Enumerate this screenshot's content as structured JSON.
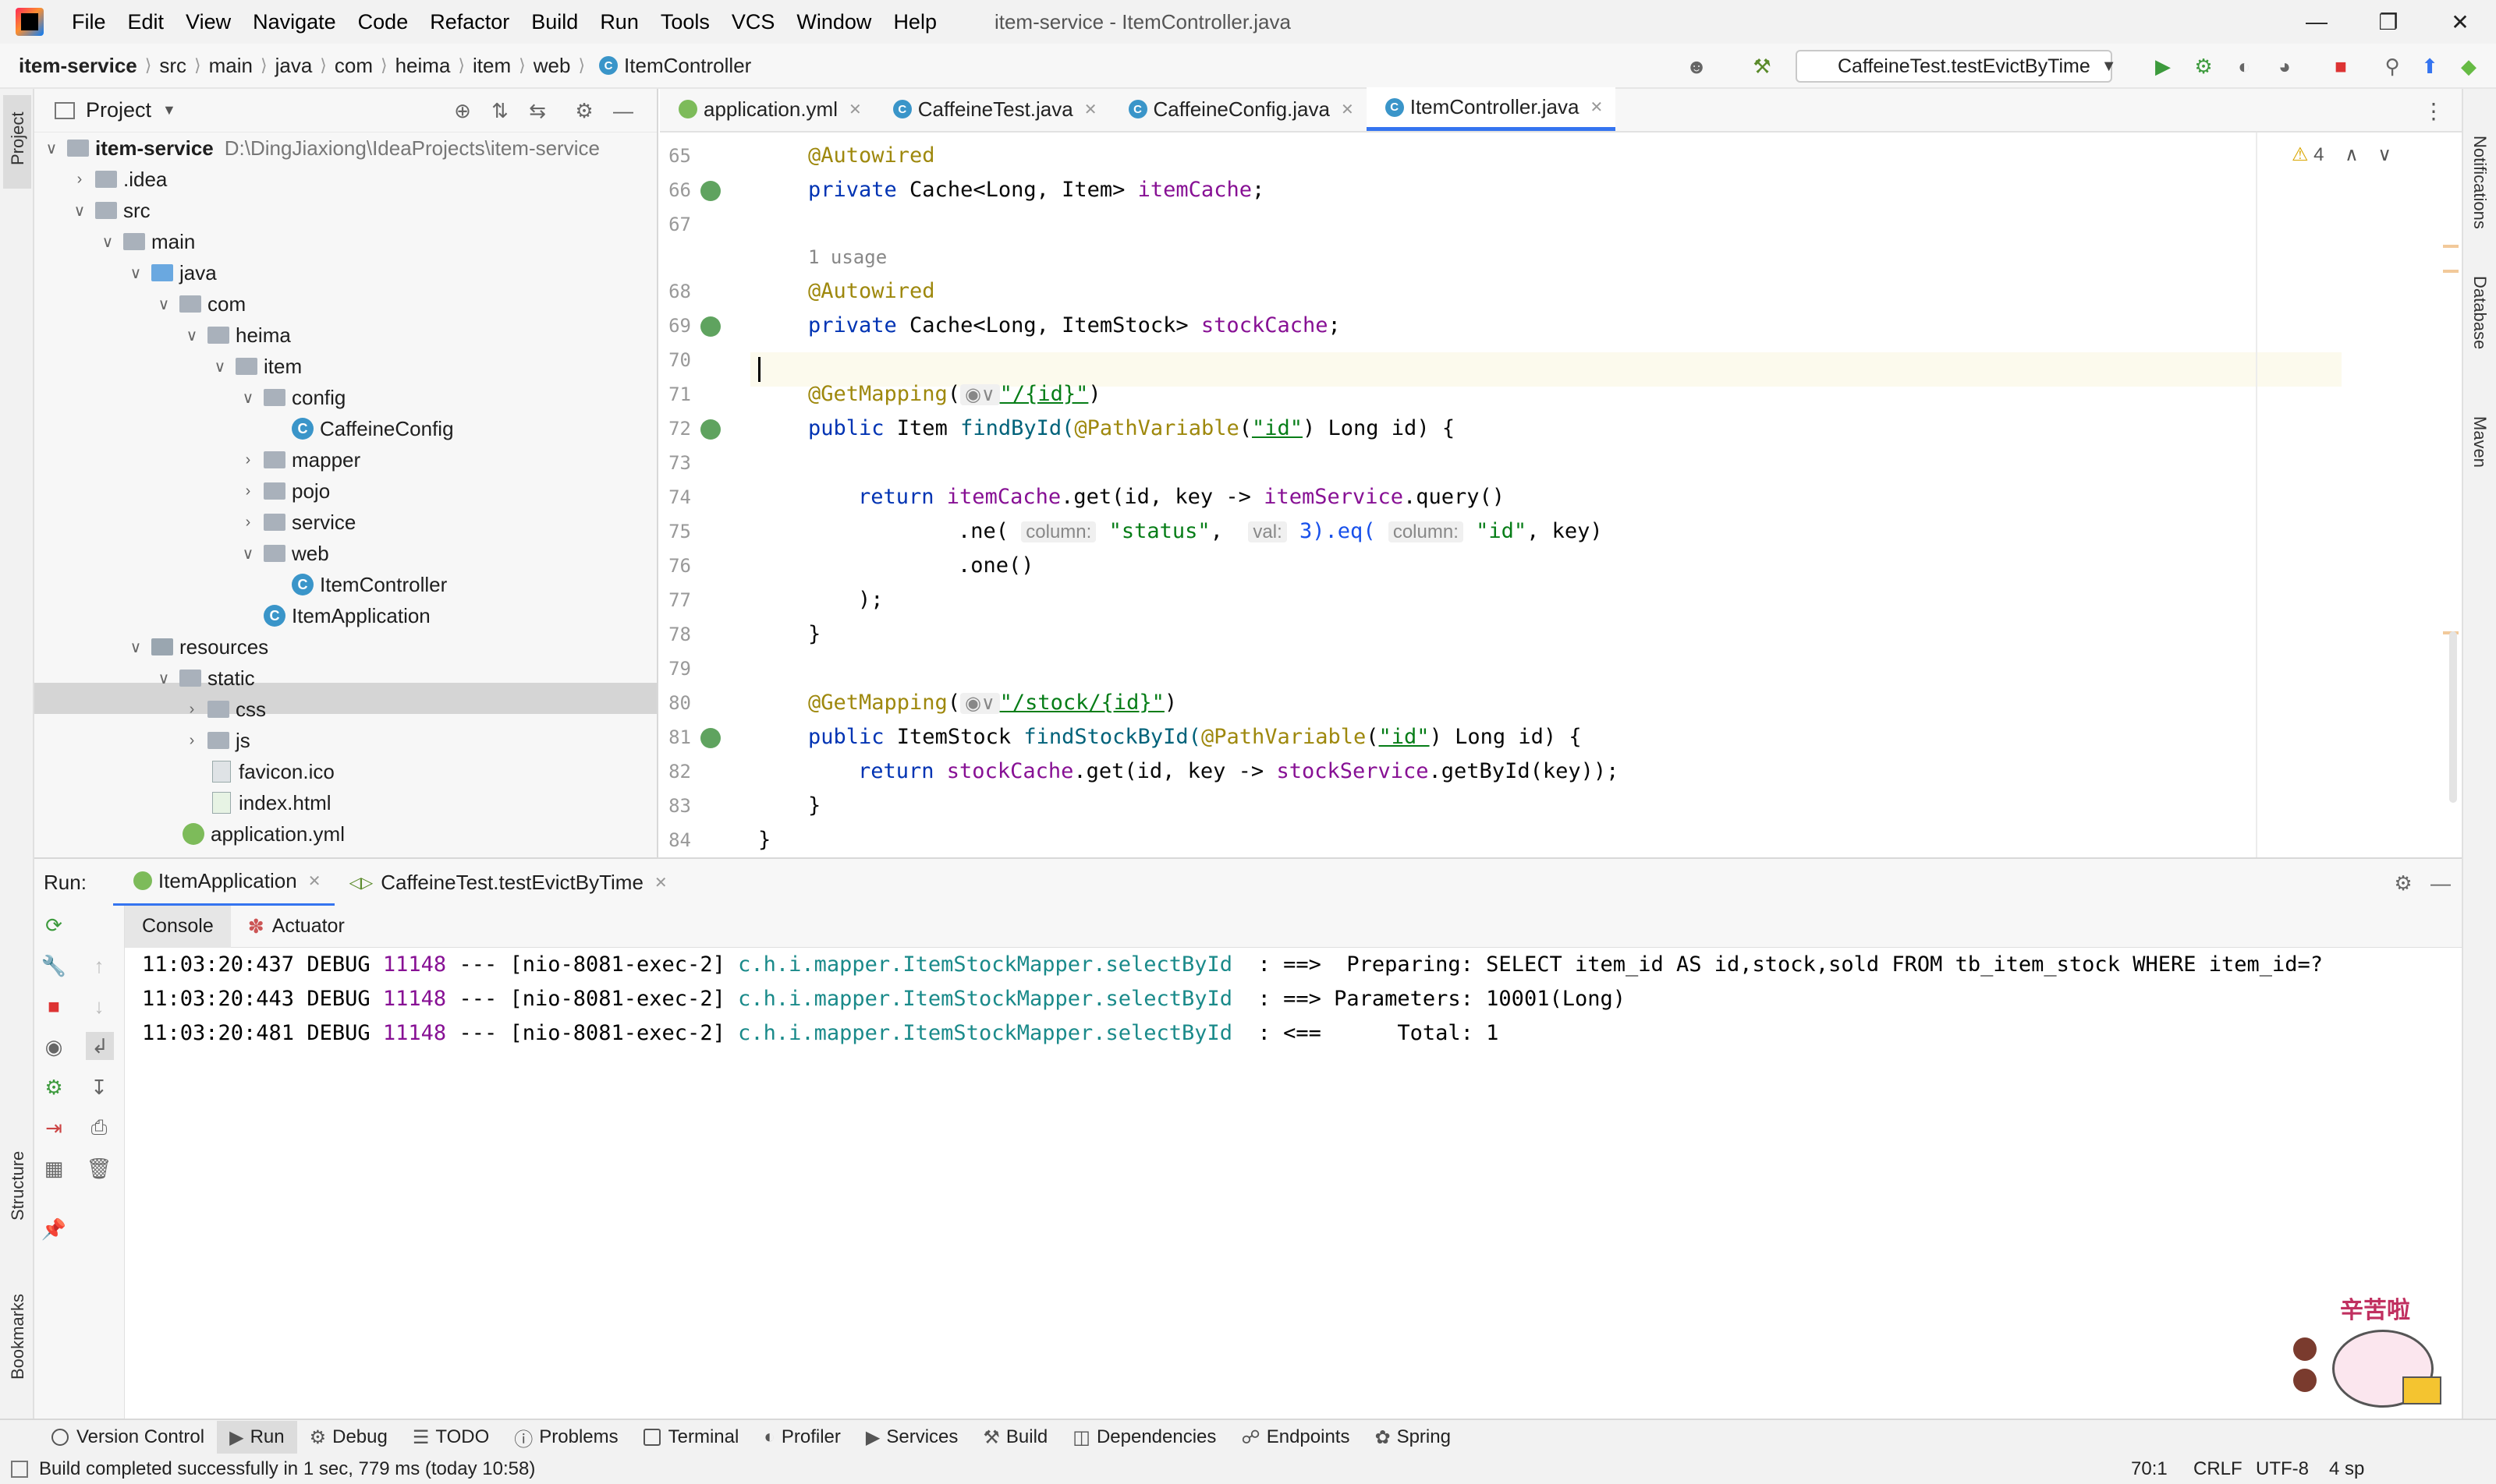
{
  "menu": [
    "File",
    "Edit",
    "View",
    "Navigate",
    "Code",
    "Refactor",
    "Build",
    "Run",
    "Tools",
    "VCS",
    "Window",
    "Help"
  ],
  "window_title": "item-service - ItemController.java",
  "breadcrumbs": [
    "item-service",
    "src",
    "main",
    "java",
    "com",
    "heima",
    "item",
    "web",
    "ItemController"
  ],
  "run_config": "CaffeineTest.testEvictByTime",
  "left_stripe": {
    "project": "Project",
    "structure": "Structure",
    "bookmarks": "Bookmarks"
  },
  "right_stripe": {
    "notifications": "Notifications",
    "database": "Database",
    "maven": "Maven"
  },
  "project": {
    "title": "Project",
    "root_name": "item-service",
    "root_path": "D:\\DingJiaxiong\\IdeaProjects\\item-service",
    "tree": [
      ".idea",
      "src",
      "main",
      "java",
      "com",
      "heima",
      "item",
      "config",
      "CaffeineConfig",
      "mapper",
      "pojo",
      "service",
      "web",
      "ItemController",
      "ItemApplication",
      "resources",
      "static",
      "css",
      "js",
      "favicon.ico",
      "index.html",
      "application.yml"
    ]
  },
  "editor_tabs": [
    "application.yml",
    "CaffeineTest.java",
    "CaffeineConfig.java",
    "ItemController.java"
  ],
  "inspection_count": "4",
  "line_numbers": [
    "65",
    "66",
    "67",
    "68",
    "69",
    "70",
    "71",
    "72",
    "73",
    "74",
    "75",
    "76",
    "77",
    "78",
    "79",
    "80",
    "81",
    "82",
    "83",
    "84"
  ],
  "code": {
    "l65": "@Autowired",
    "l66a": "private ",
    "l66b": "Cache<Long, Item> ",
    "l66c": "itemCache",
    "l66d": ";",
    "usage": "1 usage",
    "l68": "@Autowired",
    "l69a": "private ",
    "l69b": "Cache<Long, ItemStock> ",
    "l69c": "stockCache",
    "l69d": ";",
    "l71a": "@GetMapping",
    "l71b": "(",
    "l71c": "\"/{id}\"",
    "l71d": ")",
    "l72a": "public ",
    "l72b": "Item ",
    "l72c": "findById(",
    "l72d": "@PathVariable",
    "l72e": "(",
    "l72f": "\"id\"",
    "l72g": ") Long id) {",
    "l74a": "return ",
    "l74b": "itemCache",
    "l74c": ".get(id, key -> ",
    "l74d": "itemService",
    "l74e": ".query()",
    "l75a": ".ne( ",
    "l75h1": "column:",
    "l75b": " \"status\"",
    "l75c": ",  ",
    "l75h2": "val:",
    "l75d": " 3).eq( ",
    "l75h3": "column:",
    "l75e": " \"id\"",
    "l75f": ", key)",
    "l76": ".one()",
    "l77": ");",
    "l78": "}",
    "l80a": "@GetMapping",
    "l80b": "(",
    "l80c": "\"/stock/{id}\"",
    "l80d": ")",
    "l81a": "public ",
    "l81b": "ItemStock ",
    "l81c": "findStockById(",
    "l81d": "@PathVariable",
    "l81e": "(",
    "l81f": "\"id\"",
    "l81g": ") Long id) {",
    "l82a": "return ",
    "l82b": "stockCache",
    "l82c": ".get(id, key -> ",
    "l82d": "stockService",
    "l82e": ".getById(key));",
    "l83": "}",
    "l84": "}"
  },
  "run": {
    "label": "Run:",
    "tabs": [
      "ItemApplication",
      "CaffeineTest.testEvictByTime"
    ],
    "subtabs": [
      "Console",
      "Actuator"
    ],
    "logs": [
      {
        "time": "11:03:20:437",
        "level": "DEBUG",
        "pid": "11148",
        "sep": "---",
        "thread": "[nio-8081-exec-2]",
        "logger": "c.h.i.mapper.ItemStockMapper.selectById",
        "msg": ": ==>  Preparing: SELECT item_id AS id,stock,sold FROM tb_item_stock WHERE item_id=?"
      },
      {
        "time": "11:03:20:443",
        "level": "DEBUG",
        "pid": "11148",
        "sep": "---",
        "thread": "[nio-8081-exec-2]",
        "logger": "c.h.i.mapper.ItemStockMapper.selectById",
        "msg": ": ==> Parameters: 10001(Long)"
      },
      {
        "time": "11:03:20:481",
        "level": "DEBUG",
        "pid": "11148",
        "sep": "---",
        "thread": "[nio-8081-exec-2]",
        "logger": "c.h.i.mapper.ItemStockMapper.selectById",
        "msg": ": <==      Total: 1"
      }
    ]
  },
  "tool_windows": [
    "Version Control",
    "Run",
    "Debug",
    "TODO",
    "Problems",
    "Terminal",
    "Profiler",
    "Services",
    "Build",
    "Dependencies",
    "Endpoints",
    "Spring"
  ],
  "status": {
    "message": "Build completed successfully in 1 sec, 779 ms (today 10:58)",
    "position": "70:1",
    "line_sep": "CRLF",
    "encoding": "UTF-8",
    "indent": "4 sp"
  },
  "sticker_text": "辛苦啦",
  "colors": {
    "accent": "#3574f0",
    "keyword": "#0033b3",
    "annotation": "#9e880d",
    "field": "#871094",
    "string": "#067d17"
  }
}
